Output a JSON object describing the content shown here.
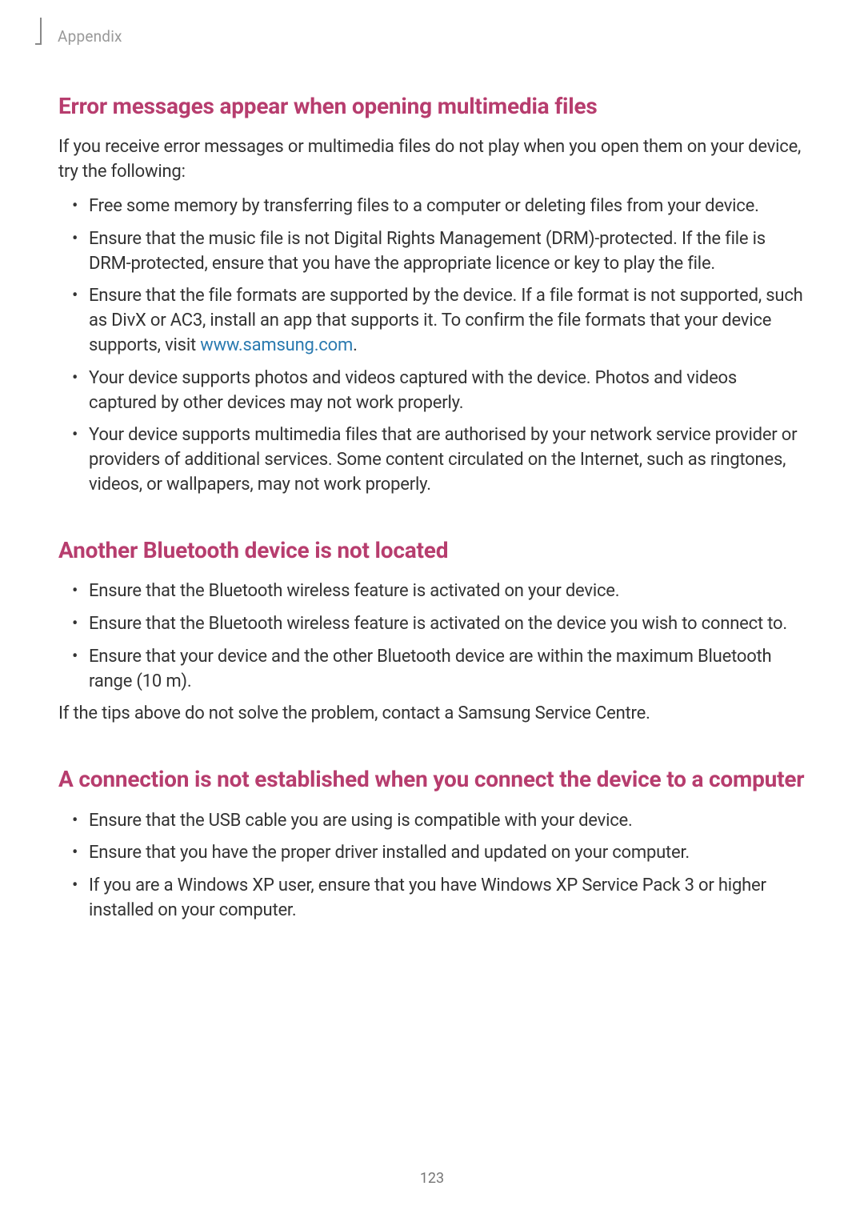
{
  "header": {
    "label": "Appendix"
  },
  "sections": {
    "multimedia": {
      "heading": "Error messages appear when opening multimedia files",
      "intro": "If you receive error messages or multimedia files do not play when you open them on your device, try the following:",
      "items": {
        "0": "Free some memory by transferring files to a computer or deleting files from your device.",
        "1": "Ensure that the music file is not Digital Rights Management (DRM)-protected. If the file is DRM-protected, ensure that you have the appropriate licence or key to play the file.",
        "2a": "Ensure that the file formats are supported by the device. If a file format is not supported, such as DivX or AC3, install an app that supports it. To confirm the file formats that your device supports, visit ",
        "2link": "www.samsung.com",
        "2b": ".",
        "3": "Your device supports photos and videos captured with the device. Photos and videos captured by other devices may not work properly.",
        "4": "Your device supports multimedia files that are authorised by your network service provider or providers of additional services. Some content circulated on the Internet, such as ringtones, videos, or wallpapers, may not work properly."
      }
    },
    "bluetooth": {
      "heading": "Another Bluetooth device is not located",
      "items": {
        "0": "Ensure that the Bluetooth wireless feature is activated on your device.",
        "1": "Ensure that the Bluetooth wireless feature is activated on the device you wish to connect to.",
        "2": "Ensure that your device and the other Bluetooth device are within the maximum Bluetooth range (10 m)."
      },
      "outro": "If the tips above do not solve the problem, contact a Samsung Service Centre."
    },
    "connection": {
      "heading": "A connection is not established when you connect the device to a computer",
      "items": {
        "0": "Ensure that the USB cable you are using is compatible with your device.",
        "1": "Ensure that you have the proper driver installed and updated on your computer.",
        "2": "If you are a Windows XP user, ensure that you have Windows XP Service Pack 3 or higher installed on your computer."
      }
    }
  },
  "page_number": "123"
}
